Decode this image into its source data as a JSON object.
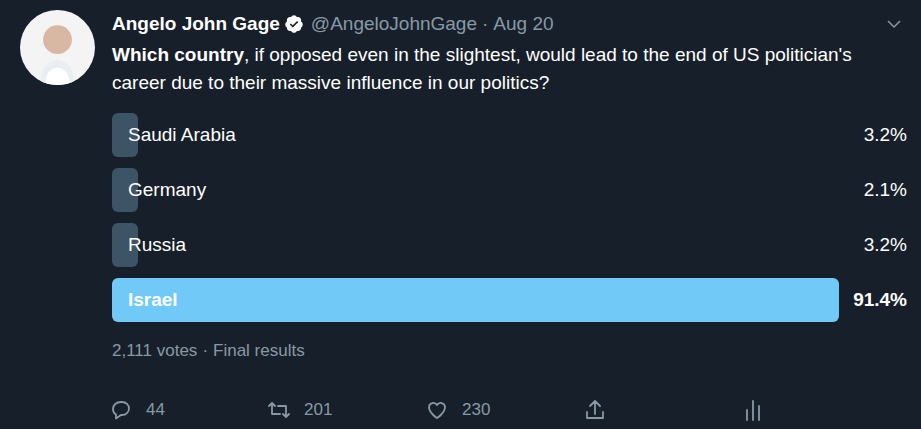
{
  "tweet": {
    "author": {
      "name": "Angelo John Gage",
      "verified": true,
      "handle": "@AngeloJohnGage",
      "separator": "·",
      "time": "Aug 20"
    },
    "question": {
      "bold": "Which country",
      "rest": ", if opposed even in the slightest, would lead to the end of US politician's career due to their massive influence in our politics?"
    },
    "poll": {
      "options": [
        {
          "label": "Saudi Arabia",
          "percent": "3.2%",
          "level": 0.032,
          "selected": false
        },
        {
          "label": "Germany",
          "percent": "2.1%",
          "level": 0.021,
          "selected": false
        },
        {
          "label": "Russia",
          "percent": "3.2%",
          "level": 0.032,
          "selected": false
        },
        {
          "label": "Israel",
          "percent": "91.4%",
          "level": 0.914,
          "selected": true
        }
      ],
      "votes": "2,111 votes",
      "separator": "·",
      "status": "Final results"
    },
    "actions": [
      {
        "kind": "reply",
        "count": "44"
      },
      {
        "kind": "retweet",
        "count": "201"
      },
      {
        "kind": "like",
        "count": "230"
      },
      {
        "kind": "share",
        "count": ""
      },
      {
        "kind": "analytics",
        "count": ""
      }
    ]
  }
}
